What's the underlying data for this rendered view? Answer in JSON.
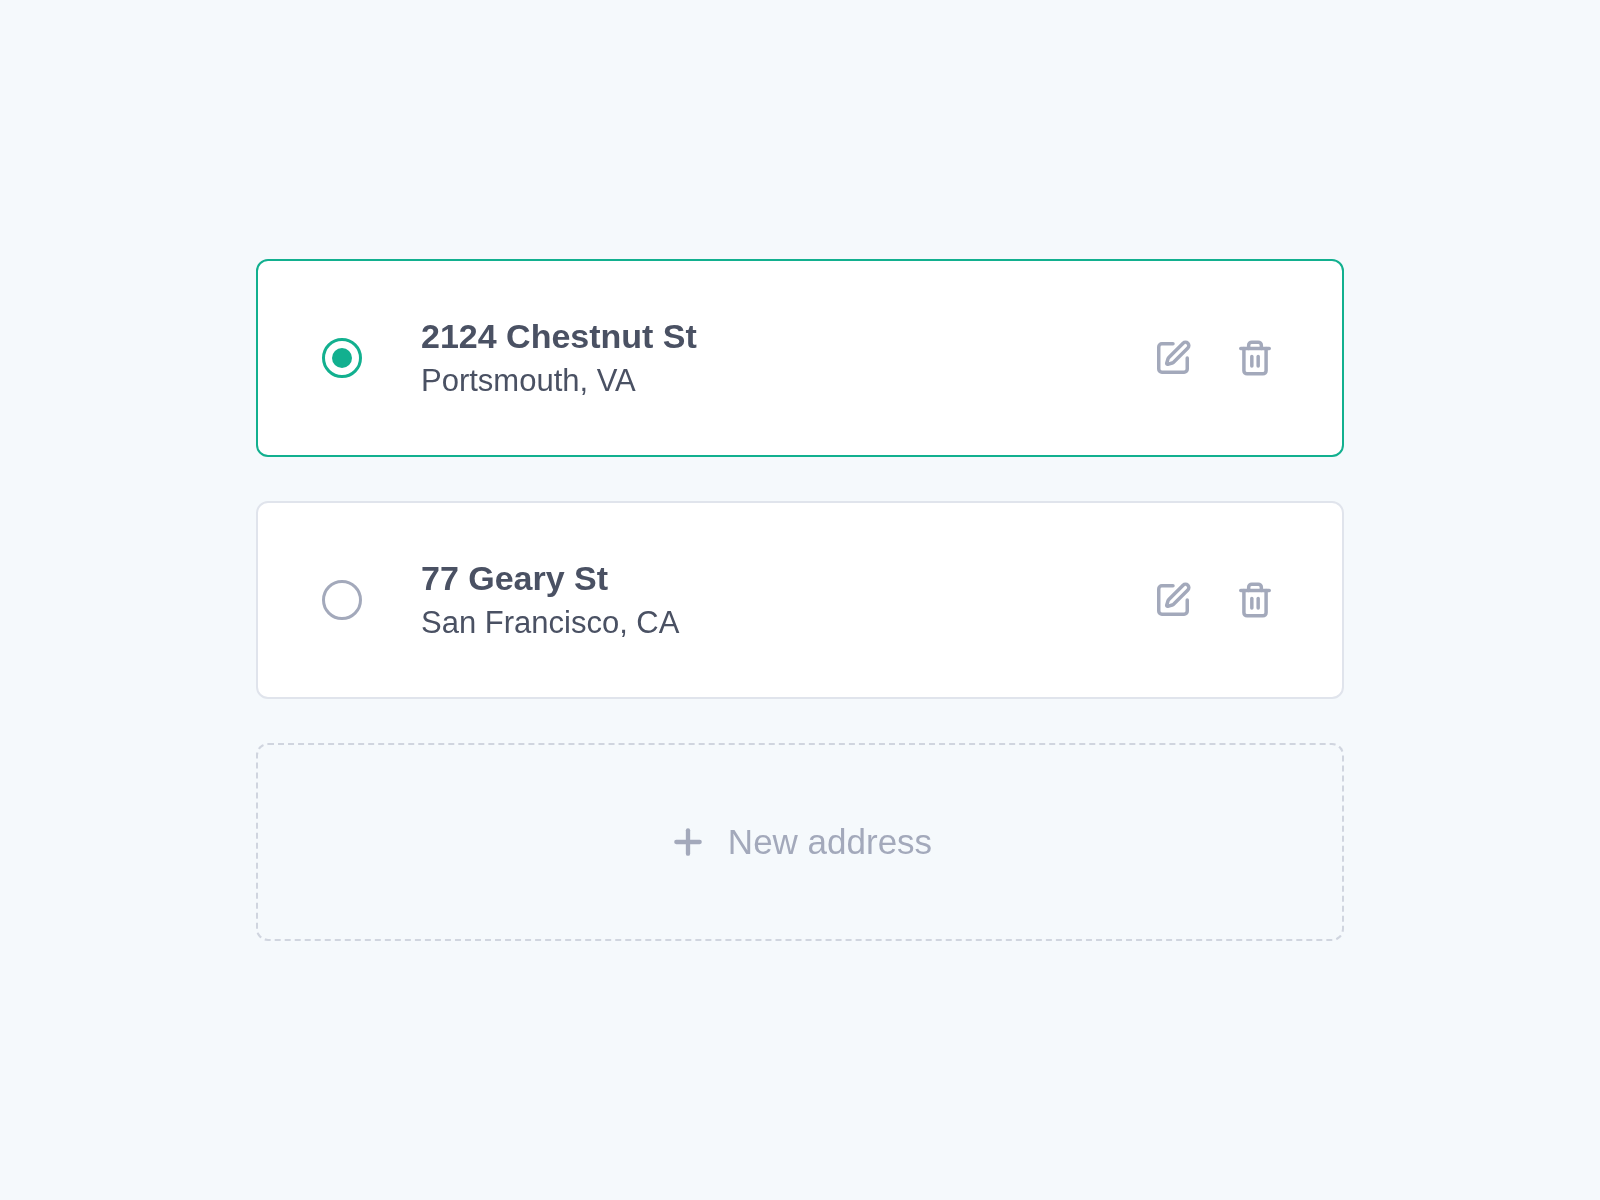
{
  "addresses": [
    {
      "street": "2124 Chestnut St",
      "city": "Portsmouth, VA",
      "selected": true
    },
    {
      "street": "77 Geary St",
      "city": "San Francisco, CA",
      "selected": false
    }
  ],
  "new_address_button": {
    "label": "New address"
  }
}
